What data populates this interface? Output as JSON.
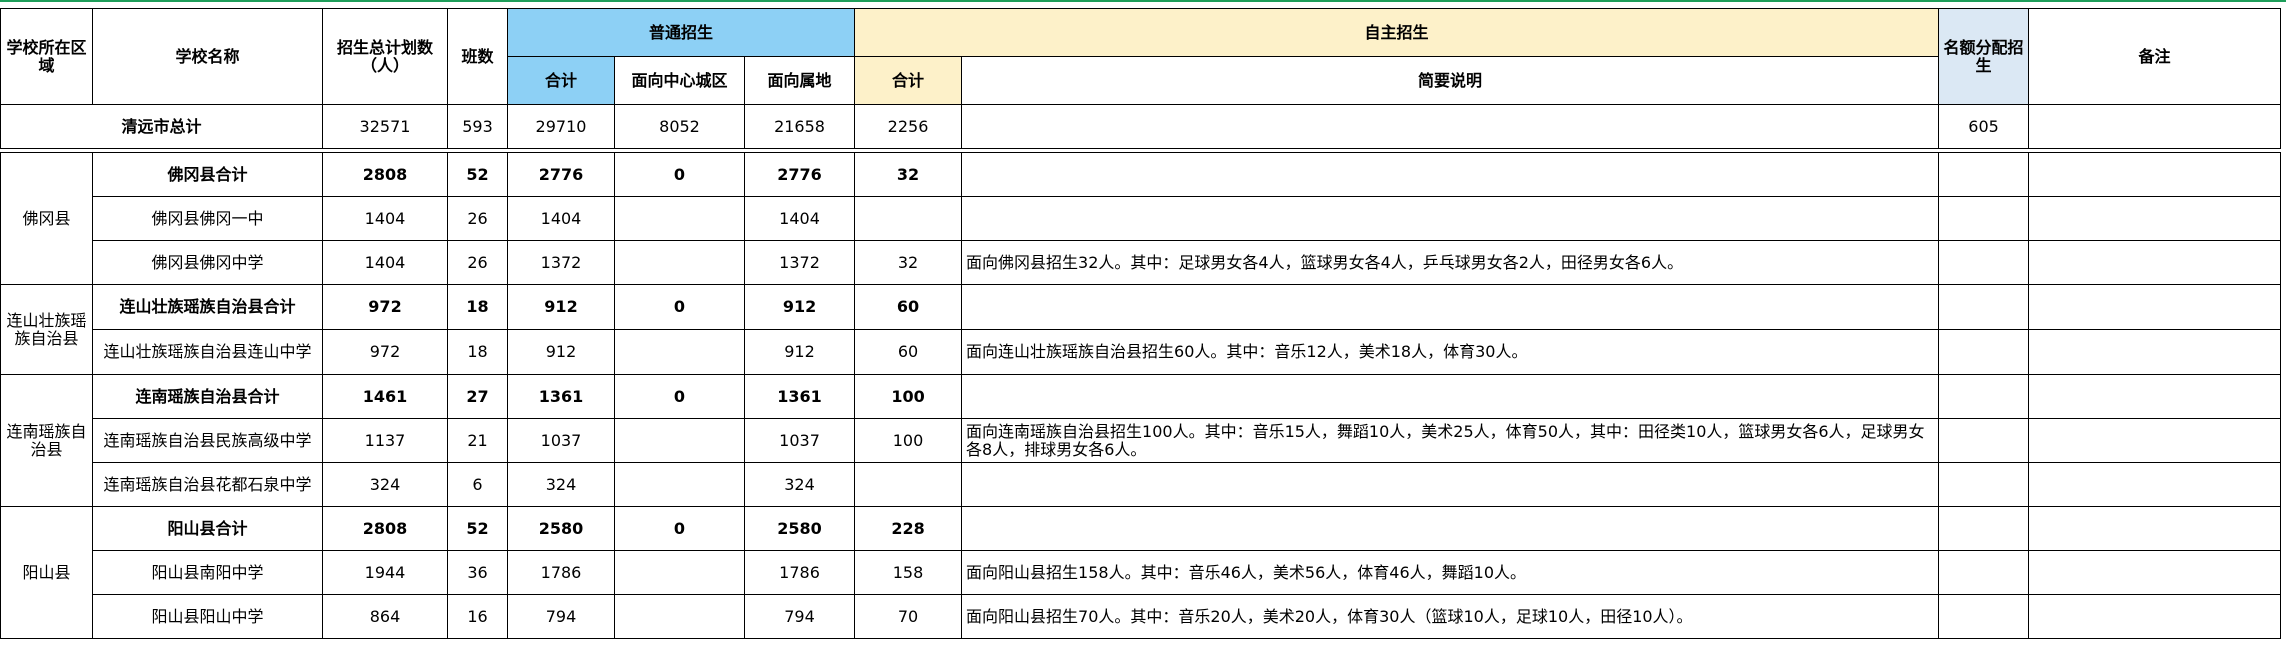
{
  "headers": {
    "region": "学校所在区域",
    "school": "学校名称",
    "plan_total": "招生总计划数（人）",
    "classes": "班数",
    "general": "普通招生",
    "general_total": "合计",
    "general_center": "面向中心城区",
    "general_local": "面向属地",
    "self": "自主招生",
    "self_total": "合计",
    "self_desc": "简要说明",
    "quota": "名额分配招生",
    "remarks": "备注"
  },
  "city_total": {
    "name": "清远市总计",
    "plan": "32571",
    "classes": "593",
    "general_total": "29710",
    "center": "8052",
    "local": "21658",
    "self_total": "2256",
    "quota": "605"
  },
  "regions": [
    {
      "name": "佛冈县",
      "summary": {
        "name": "佛冈县合计",
        "plan": "2808",
        "classes": "52",
        "general_total": "2776",
        "center": "0",
        "local": "2776",
        "self_total": "32"
      },
      "schools": [
        {
          "name": "佛冈县佛冈一中",
          "plan": "1404",
          "classes": "26",
          "general_total": "1404",
          "local": "1404",
          "self_total": "",
          "desc": ""
        },
        {
          "name": "佛冈县佛冈中学",
          "plan": "1404",
          "classes": "26",
          "general_total": "1372",
          "local": "1372",
          "self_total": "32",
          "desc": "面向佛冈县招生32人。其中：足球男女各4人，篮球男女各4人，乒乓球男女各2人，田径男女各6人。"
        }
      ]
    },
    {
      "name": "连山壮族瑶族自治县",
      "summary": {
        "name": "连山壮族瑶族自治县合计",
        "plan": "972",
        "classes": "18",
        "general_total": "912",
        "center": "0",
        "local": "912",
        "self_total": "60"
      },
      "schools": [
        {
          "name": "连山壮族瑶族自治县连山中学",
          "plan": "972",
          "classes": "18",
          "general_total": "912",
          "local": "912",
          "self_total": "60",
          "desc": "面向连山壮族瑶族自治县招生60人。其中：音乐12人，美术18人，体育30人。"
        }
      ]
    },
    {
      "name": "连南瑶族自治县",
      "summary": {
        "name": "连南瑶族自治县合计",
        "plan": "1461",
        "classes": "27",
        "general_total": "1361",
        "center": "0",
        "local": "1361",
        "self_total": "100"
      },
      "schools": [
        {
          "name": "连南瑶族自治县民族高级中学",
          "plan": "1137",
          "classes": "21",
          "general_total": "1037",
          "local": "1037",
          "self_total": "100",
          "desc": "面向连南瑶族自治县招生100人。其中：音乐15人，舞蹈10人，美术25人，体育50人，其中：田径类10人，篮球男女各6人，足球男女各8人，排球男女各6人。"
        },
        {
          "name": "连南瑶族自治县花都石泉中学",
          "plan": "324",
          "classes": "6",
          "general_total": "324",
          "local": "324",
          "self_total": "",
          "desc": ""
        }
      ]
    },
    {
      "name": "阳山县",
      "summary": {
        "name": "阳山县合计",
        "plan": "2808",
        "classes": "52",
        "general_total": "2580",
        "center": "0",
        "local": "2580",
        "self_total": "228"
      },
      "schools": [
        {
          "name": "阳山县南阳中学",
          "plan": "1944",
          "classes": "36",
          "general_total": "1786",
          "local": "1786",
          "self_total": "158",
          "desc": "面向阳山县招生158人。其中：音乐46人，美术56人，体育46人，舞蹈10人。"
        },
        {
          "name": "阳山县阳山中学",
          "plan": "864",
          "classes": "16",
          "general_total": "794",
          "local": "794",
          "self_total": "70",
          "desc": "面向阳山县招生70人。其中：音乐20人，美术20人，体育30人（篮球10人，足球10人，田径10人）。"
        }
      ]
    }
  ]
}
